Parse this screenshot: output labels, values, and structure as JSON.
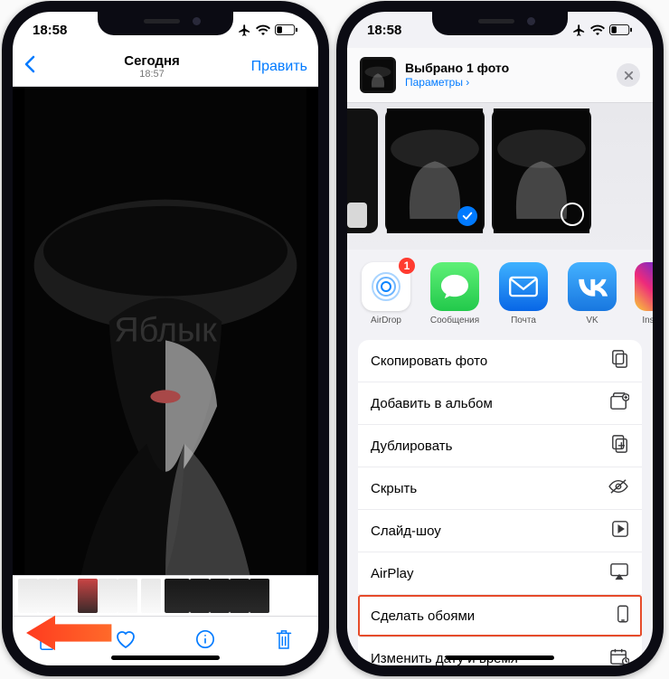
{
  "status": {
    "time": "18:58"
  },
  "left": {
    "nav": {
      "title": "Сегодня",
      "subtitle": "18:57",
      "edit": "Править"
    }
  },
  "right": {
    "header": {
      "title": "Выбрано 1 фото",
      "params": "Параметры ›"
    },
    "apps": [
      {
        "label": "AirDrop",
        "badge": "1"
      },
      {
        "label": "Сообщения"
      },
      {
        "label": "Почта"
      },
      {
        "label": "VK"
      },
      {
        "label": "Ins"
      }
    ],
    "actions": {
      "copy": "Скопировать фото",
      "album": "Добавить в альбом",
      "dup": "Дублировать",
      "hide": "Скрыть",
      "slide": "Слайд-шоу",
      "airplay": "AirPlay",
      "wall": "Сделать обоями",
      "date": "Изменить дату и время"
    }
  },
  "watermark": "Яблык"
}
